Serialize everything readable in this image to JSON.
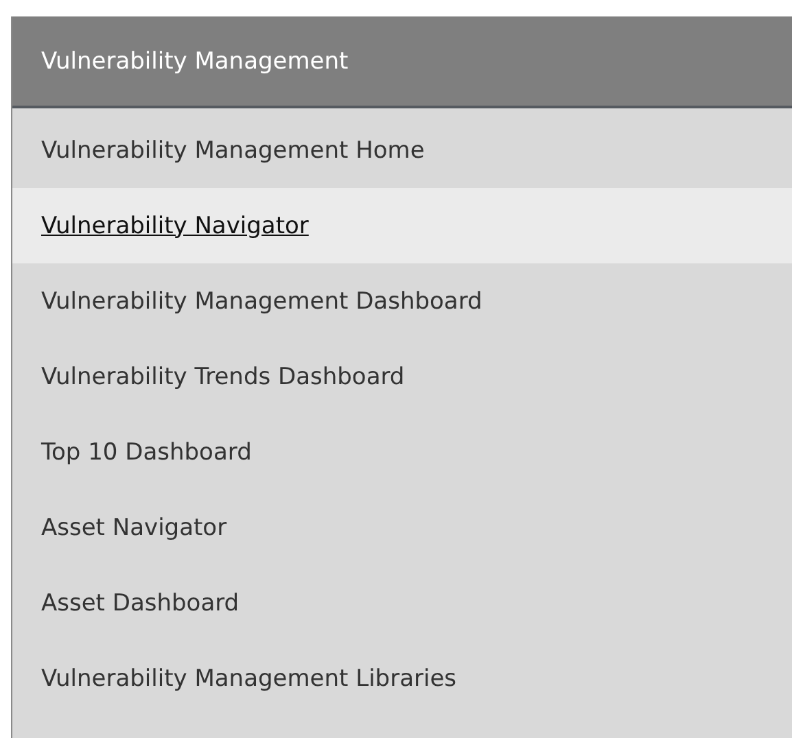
{
  "panel": {
    "title": "Vulnerability Management"
  },
  "menu": [
    {
      "label": "Vulnerability Management Home",
      "selected": false
    },
    {
      "label": "Vulnerability Navigator",
      "selected": true
    },
    {
      "label": "Vulnerability Management Dashboard",
      "selected": false
    },
    {
      "label": "Vulnerability Trends Dashboard",
      "selected": false
    },
    {
      "label": "Top 10 Dashboard",
      "selected": false
    },
    {
      "label": "Asset Navigator",
      "selected": false
    },
    {
      "label": "Asset Dashboard",
      "selected": false
    },
    {
      "label": "Vulnerability Management Libraries",
      "selected": false
    }
  ]
}
